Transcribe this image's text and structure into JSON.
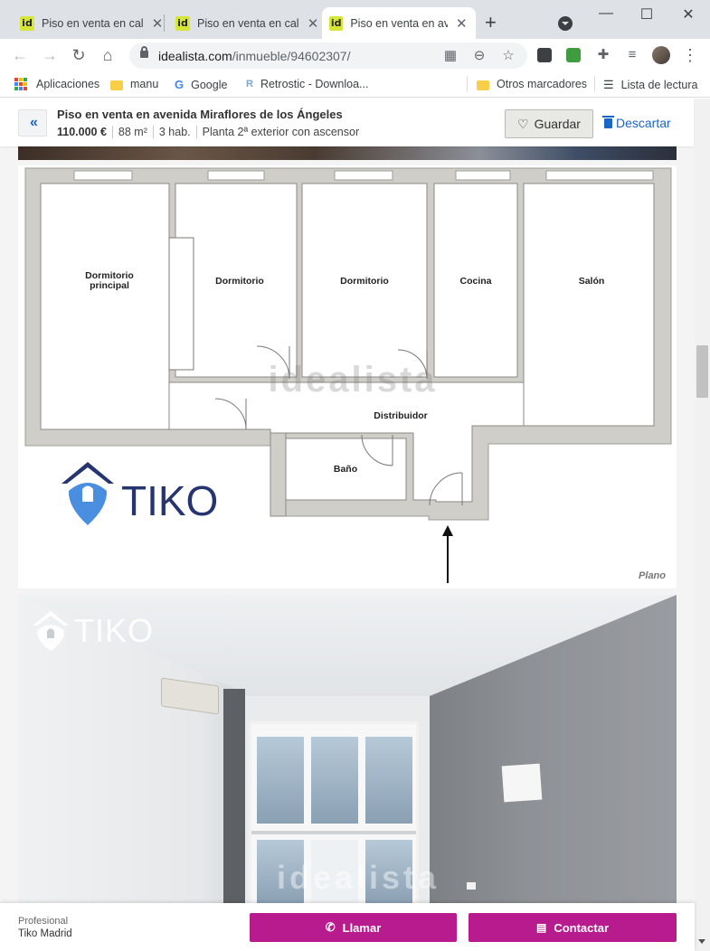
{
  "browser": {
    "tabs": [
      {
        "favicon": "id",
        "title": "Piso en venta en calle",
        "close": "✕",
        "active": false
      },
      {
        "favicon": "id",
        "title": "Piso en venta en calle",
        "close": "✕",
        "active": false
      },
      {
        "favicon": "id",
        "title": "Piso en venta en avenida",
        "close": "✕",
        "active": true
      }
    ],
    "new_tab": "+",
    "window_controls": [
      "—",
      "☐",
      "✕"
    ],
    "url_domain": "idealista.com",
    "url_path": "/inmueble/94602307/",
    "bookmarks": [
      {
        "label": "Aplicaciones",
        "icon": "apps-grid-icon"
      },
      {
        "label": "manu",
        "icon": "folder-icon"
      },
      {
        "label": "Google",
        "icon": "google-icon"
      },
      {
        "label": "Retrostic - Downloa...",
        "icon": "retrostic-icon"
      },
      {
        "label": "Otros marcadores",
        "icon": "folder-icon"
      },
      {
        "label": "Lista de lectura",
        "icon": "reading-list-icon"
      }
    ]
  },
  "listing": {
    "title": "Piso en venta en avenida Miraflores de los Ángeles",
    "price": "110.000 €",
    "area": "88 m²",
    "rooms": "3 hab.",
    "floor": "Planta 2ª exterior con ascensor",
    "save_label": "Guardar",
    "discard_label": "Descartar"
  },
  "floorplan": {
    "rooms": {
      "master": [
        "Dormitorio",
        "principal"
      ],
      "bedroom_a": "Dormitorio",
      "bedroom_b": "Dormitorio",
      "kitchen": "Cocina",
      "living": "Salón",
      "hall": "Distribuidor",
      "bath": "Baño"
    },
    "watermark": "idealista",
    "brand": "TIKO",
    "caption": "Plano"
  },
  "photo": {
    "watermark": "idealista",
    "brand": "TIKO"
  },
  "contact_bar": {
    "role": "Profesional",
    "agency": "Tiko Madrid",
    "call_label": "Llamar",
    "contact_label": "Contactar"
  },
  "colors": {
    "accent_blue": "#1b65c3",
    "cta_magenta": "#b81b8e",
    "favicon_yellow": "#d6e636",
    "tiko_navy": "#26356f",
    "tiko_blue": "#4a8fdf"
  }
}
